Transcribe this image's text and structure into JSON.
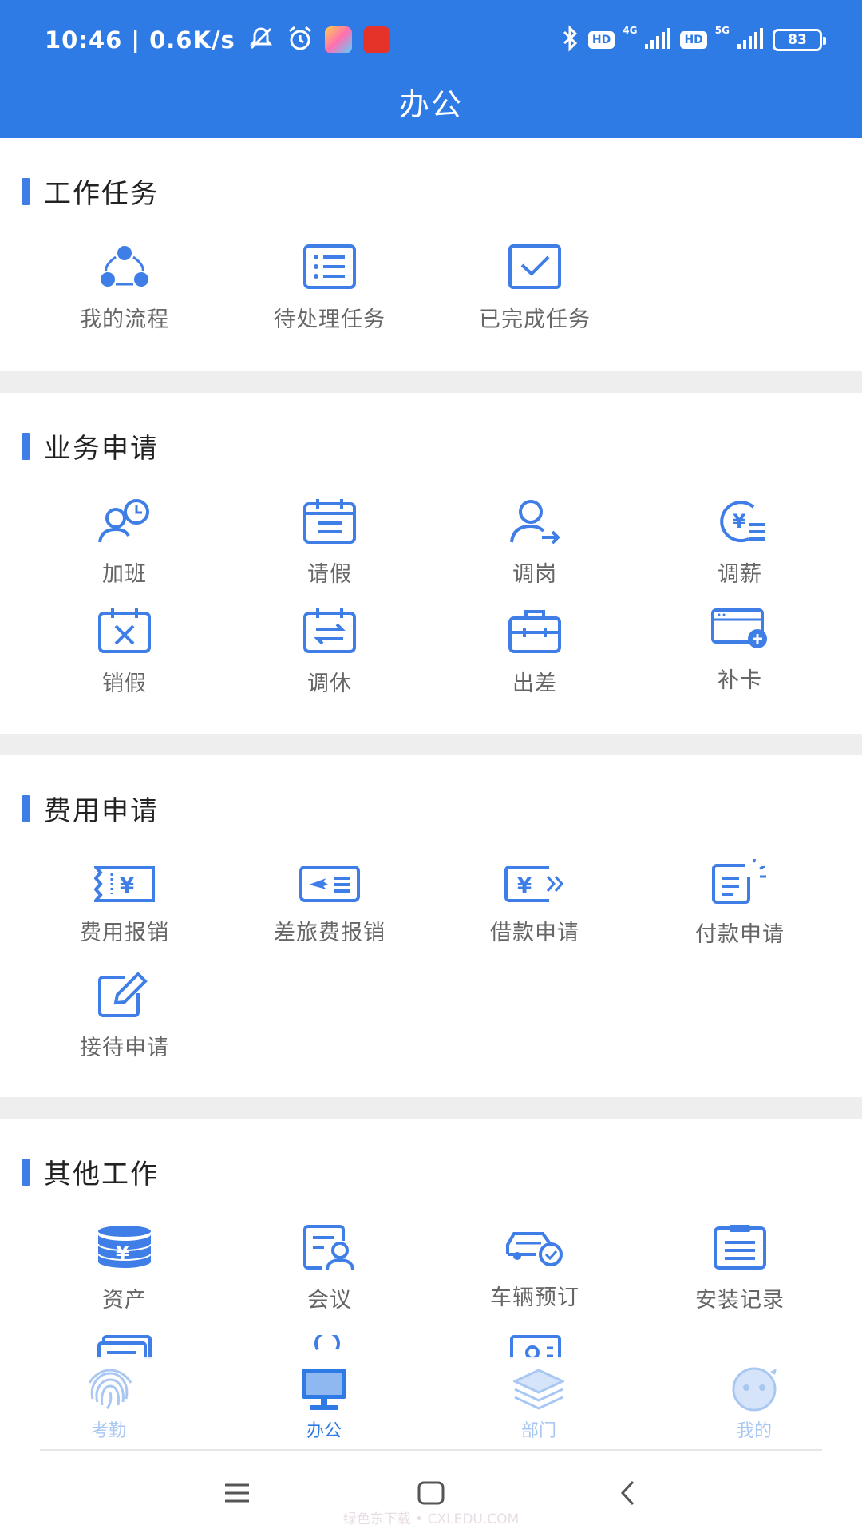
{
  "status_bar": {
    "time": "10:46 | 0.6K/s",
    "hd1": "HD",
    "net1": "4G",
    "hd2": "HD",
    "net2": "5G",
    "battery": "83"
  },
  "header": {
    "title": "办公"
  },
  "sections": [
    {
      "title": "工作任务",
      "items": [
        {
          "label": "我的流程",
          "icon": "workflow-icon"
        },
        {
          "label": "待处理任务",
          "icon": "list-icon"
        },
        {
          "label": "已完成任务",
          "icon": "checkbox-icon"
        }
      ]
    },
    {
      "title": "业务申请",
      "items": [
        {
          "label": "加班",
          "icon": "overtime-icon"
        },
        {
          "label": "请假",
          "icon": "calendar-icon"
        },
        {
          "label": "调岗",
          "icon": "transfer-user-icon"
        },
        {
          "label": "调薪",
          "icon": "salary-icon"
        },
        {
          "label": "销假",
          "icon": "calendar-cancel-icon"
        },
        {
          "label": "调休",
          "icon": "calendar-swap-icon"
        },
        {
          "label": "出差",
          "icon": "briefcase-icon"
        },
        {
          "label": "补卡",
          "icon": "card-add-icon"
        }
      ]
    },
    {
      "title": "费用申请",
      "items": [
        {
          "label": "费用报销",
          "icon": "receipt-yen-icon"
        },
        {
          "label": "差旅费报销",
          "icon": "travel-ticket-icon"
        },
        {
          "label": "借款申请",
          "icon": "loan-icon"
        },
        {
          "label": "付款申请",
          "icon": "payment-doc-icon"
        },
        {
          "label": "接待申请",
          "icon": "edit-icon"
        }
      ]
    },
    {
      "title": "其他工作",
      "items": [
        {
          "label": "资产",
          "icon": "coins-icon"
        },
        {
          "label": "会议",
          "icon": "meeting-icon"
        },
        {
          "label": "车辆预订",
          "icon": "car-icon"
        },
        {
          "label": "安装记录",
          "icon": "clipboard-icon"
        }
      ]
    }
  ],
  "bottom_nav": [
    {
      "label": "考勤",
      "icon": "fingerprint-icon",
      "active": false
    },
    {
      "label": "办公",
      "icon": "computer-icon",
      "active": true
    },
    {
      "label": "部门",
      "icon": "layers-icon",
      "active": false
    },
    {
      "label": "我的",
      "icon": "face-icon",
      "active": false
    }
  ],
  "colors": {
    "primary": "#2f7be5",
    "icon": "#3e7ee6",
    "label": "#666666",
    "nav_inactive": "#a9c7f3",
    "divider": "#eeeeee"
  },
  "watermark": "绿色东下载 • CXLEDU.COM"
}
